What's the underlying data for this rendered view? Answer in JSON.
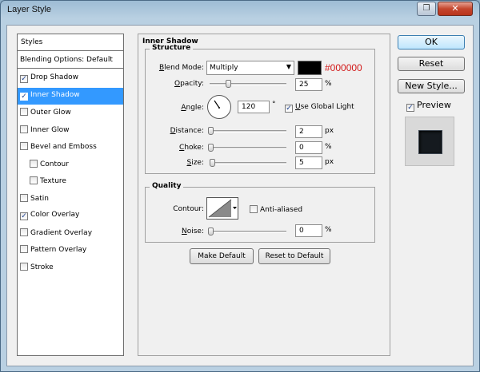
{
  "window": {
    "title": "Layer Style"
  },
  "styles_list": {
    "header": "Styles",
    "blending_options": "Blending Options: Default",
    "items": [
      {
        "label": "Drop Shadow",
        "checked": true,
        "sub": false,
        "selected": false
      },
      {
        "label": "Inner Shadow",
        "checked": true,
        "sub": false,
        "selected": true
      },
      {
        "label": "Outer Glow",
        "checked": false,
        "sub": false,
        "selected": false
      },
      {
        "label": "Inner Glow",
        "checked": false,
        "sub": false,
        "selected": false
      },
      {
        "label": "Bevel and Emboss",
        "checked": false,
        "sub": false,
        "selected": false
      },
      {
        "label": "Contour",
        "checked": false,
        "sub": true,
        "selected": false
      },
      {
        "label": "Texture",
        "checked": false,
        "sub": true,
        "selected": false
      },
      {
        "label": "Satin",
        "checked": false,
        "sub": false,
        "selected": false
      },
      {
        "label": "Color Overlay",
        "checked": true,
        "sub": false,
        "selected": false
      },
      {
        "label": "Gradient Overlay",
        "checked": false,
        "sub": false,
        "selected": false
      },
      {
        "label": "Pattern Overlay",
        "checked": false,
        "sub": false,
        "selected": false
      },
      {
        "label": "Stroke",
        "checked": false,
        "sub": false,
        "selected": false
      }
    ]
  },
  "panel": {
    "title": "Inner Shadow",
    "structure": {
      "title": "Structure",
      "blend_mode_label": "Blend Mode:",
      "blend_mode_value": "Multiply",
      "color_hex": "#000000",
      "opacity_label": "Opacity:",
      "opacity_value": "25",
      "opacity_unit": "%",
      "angle_label": "Angle:",
      "angle_value": "120",
      "angle_unit": "°",
      "use_global_light_label": "Use Global Light",
      "use_global_light": true,
      "distance_label": "Distance:",
      "distance_value": "2",
      "distance_unit": "px",
      "choke_label": "Choke:",
      "choke_value": "0",
      "choke_unit": "%",
      "size_label": "Size:",
      "size_value": "5",
      "size_unit": "px"
    },
    "quality": {
      "title": "Quality",
      "contour_label": "Contour:",
      "anti_aliased_label": "Anti-aliased",
      "anti_aliased": false,
      "noise_label": "Noise:",
      "noise_value": "0",
      "noise_unit": "%"
    },
    "make_default_label": "Make Default",
    "reset_default_label": "Reset to Default"
  },
  "buttons": {
    "ok": "OK",
    "reset": "Reset",
    "new_style": "New Style...",
    "preview_label": "Preview",
    "preview_checked": true
  },
  "sliders": {
    "opacity": 0.25,
    "distance": 0.0,
    "choke": 0.0,
    "size": 0.02,
    "noise": 0.0
  },
  "colors": {
    "selection": "#3399ff",
    "shadow_color": "#000000",
    "hex_label_color": "#d21a1a"
  }
}
